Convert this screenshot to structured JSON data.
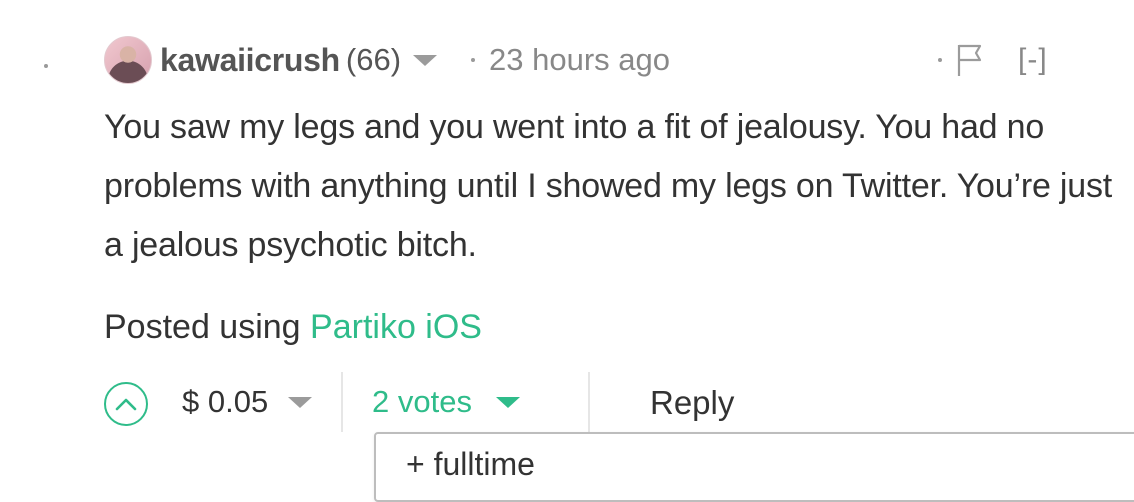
{
  "comment": {
    "author": "kawaiicrush",
    "reputation": "(66)",
    "timestamp": "23 hours ago",
    "collapse_label": "[-]",
    "body": "You saw my legs and you went into a fit of jealousy. You had no problems with anything until I showed my legs on Twitter. You’re just a jealous psychotic bitch.",
    "posted_prefix": "Posted using ",
    "posted_app": "Partiko iOS"
  },
  "footer": {
    "payout": "$ 0.05",
    "votes": "2 votes",
    "reply_label": "Reply"
  },
  "votes_dropdown": {
    "voters": [
      "+ fulltime"
    ]
  },
  "icons": {
    "upvote": "chevron-up-icon",
    "author_menu": "caret-down-icon",
    "flag": "flag-icon"
  },
  "colors": {
    "accent": "#2fbc8a",
    "text": "#333333",
    "muted": "#888888"
  }
}
